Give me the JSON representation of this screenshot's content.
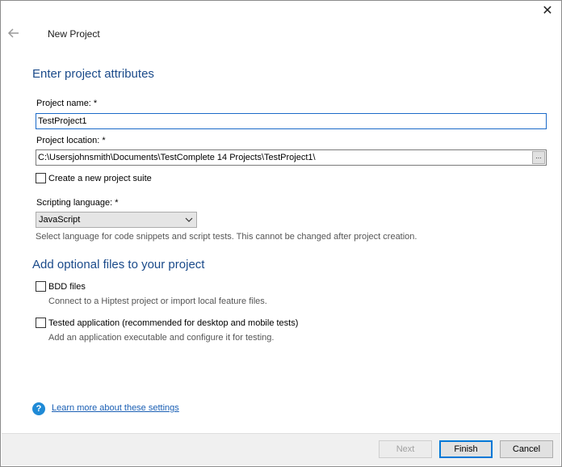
{
  "dialog": {
    "title": "New Project",
    "close_glyph": "✕"
  },
  "attributes": {
    "heading": "Enter project attributes",
    "name_label": "Project name: *",
    "name_value": "TestProject1",
    "location_label": "Project location: *",
    "location_value": "C:\\Usersjohnsmith\\Documents\\TestComplete 14 Projects\\TestProject1\\",
    "browse_label": "...",
    "suite_label": "Create a new project suite",
    "language_label": "Scripting language: *",
    "language_value": "JavaScript",
    "language_hint": "Select language for code snippets and script tests. This cannot be changed after project creation."
  },
  "optional": {
    "heading": "Add optional files to your project",
    "bdd_label": "BDD files",
    "bdd_hint": "Connect to a Hiptest project or import local feature files.",
    "app_label": "Tested application (recommended for desktop and mobile tests)",
    "app_hint": "Add an application executable and configure it for testing."
  },
  "help": {
    "icon_glyph": "?",
    "link_text": "Learn more about these settings"
  },
  "footer": {
    "next_label": "Next",
    "finish_label": "Finish",
    "cancel_label": "Cancel"
  },
  "icons": {
    "back": "back-arrow-icon",
    "close": "close-icon",
    "help": "help-icon",
    "dropdown": "chevron-down-icon"
  },
  "colors": {
    "heading": "#1a4a8a",
    "link": "#1a5fb4",
    "help_icon": "#1f8ad6",
    "focus_border": "#1b6ac9"
  }
}
